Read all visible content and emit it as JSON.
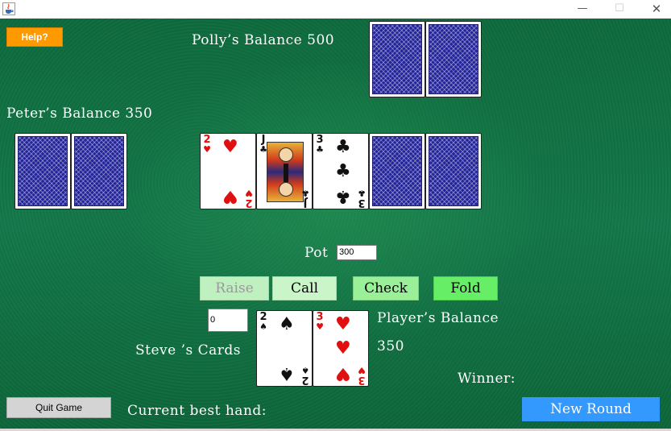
{
  "window": {
    "icon": "java-cup-icon",
    "minimize_glyph": "—",
    "maximize_glyph": "☐",
    "close_glyph": "✕"
  },
  "colors": {
    "felt": "#0f6f40",
    "help_button": "#ff9900",
    "new_round_button": "#3399ff",
    "fold_button": "#66ee66",
    "check_button": "#99f099",
    "call_button": "#c9f5c9",
    "raise_button_disabled": "#bff0bf",
    "red_suit": "#e01010",
    "card_back": "#23239a"
  },
  "help_button": "Help?",
  "polly": {
    "balance_label": "Polly’s Balance 500",
    "cards": [
      "face-down",
      "face-down"
    ]
  },
  "peter": {
    "balance_label": "Peter’s Balance 350",
    "cards": [
      "face-down",
      "face-down"
    ]
  },
  "community_cards": [
    {
      "rank": "2",
      "suit": "♥",
      "color": "red"
    },
    {
      "rank": "J",
      "suit": "♣",
      "color": "black"
    },
    {
      "rank": "3",
      "suit": "♣",
      "color": "black"
    },
    {
      "rank": "",
      "suit": "",
      "face_down": true
    },
    {
      "rank": "",
      "suit": "",
      "face_down": true
    }
  ],
  "pot": {
    "label": "Pot",
    "value": "300"
  },
  "actions": {
    "raise": "Raise",
    "call": "Call",
    "check": "Check",
    "fold": "Fold",
    "raise_enabled": false
  },
  "raise_amount": "0",
  "player": {
    "cards_label": "Steve   ’s Cards",
    "balance_label": "Player’s Balance",
    "balance_value": "350",
    "cards": [
      {
        "rank": "2",
        "suit": "♠",
        "color": "black"
      },
      {
        "rank": "3",
        "suit": "♥",
        "color": "red"
      }
    ]
  },
  "winner_label": "Winner:",
  "best_hand_label": "Current best hand:",
  "quit_button": "Quit Game",
  "new_round_button": "New Round"
}
